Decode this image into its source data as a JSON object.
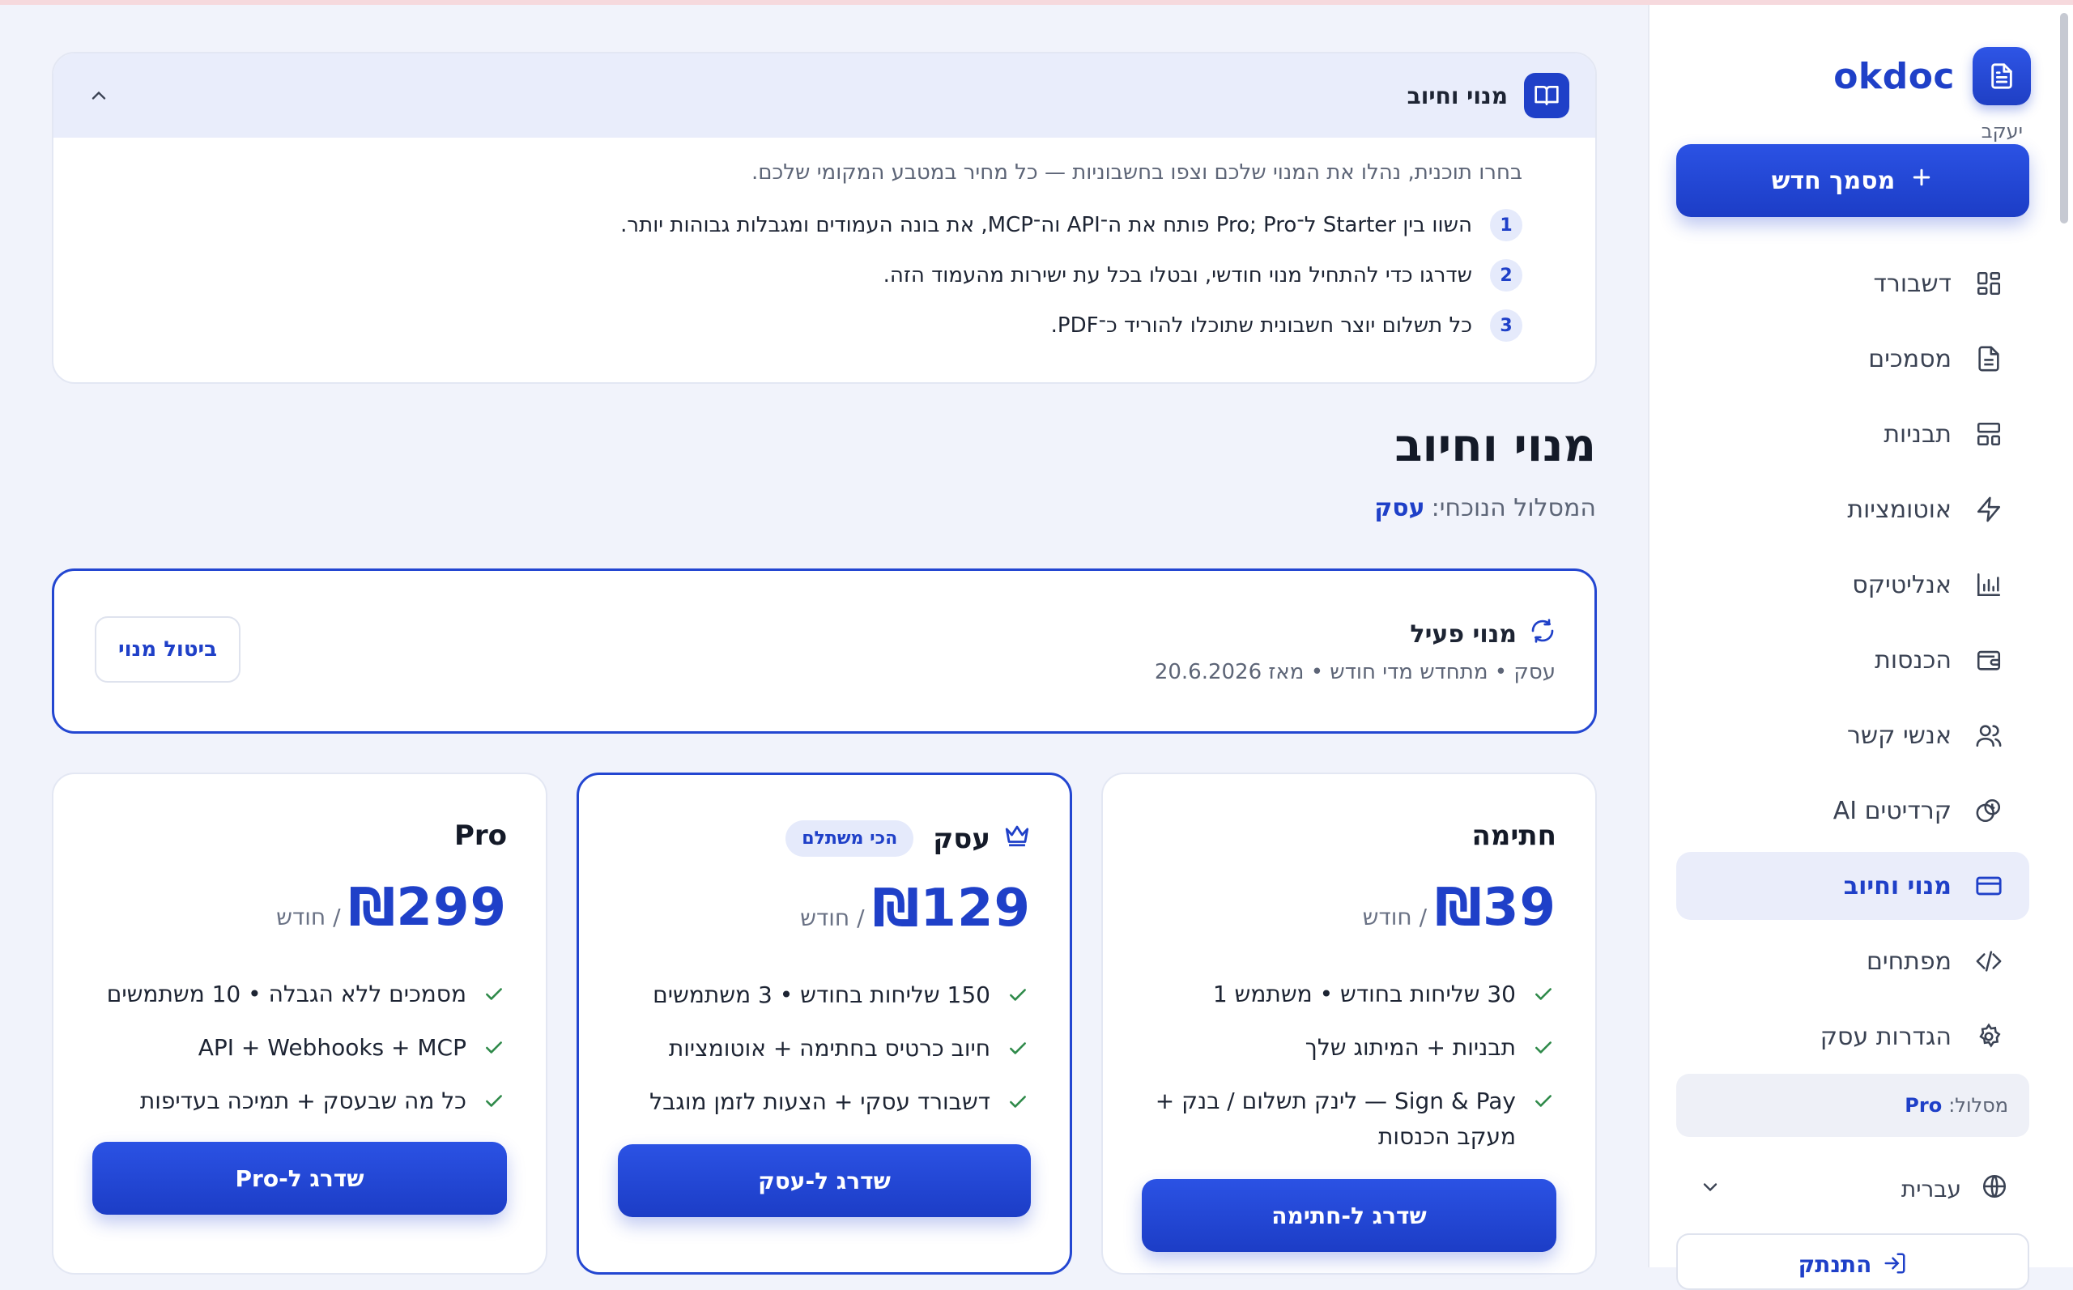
{
  "brand": {
    "name": "okdoc",
    "user": "יעקב"
  },
  "sidebar": {
    "new_doc": "מסמך חדש",
    "items": [
      {
        "label": "דשבורד",
        "icon": "dashboard-icon"
      },
      {
        "label": "מסמכים",
        "icon": "document-icon"
      },
      {
        "label": "תבניות",
        "icon": "templates-icon"
      },
      {
        "label": "אוטומציות",
        "icon": "lightning-icon"
      },
      {
        "label": "אנליטיקס",
        "icon": "analytics-icon"
      },
      {
        "label": "הכנסות",
        "icon": "wallet-icon"
      },
      {
        "label": "אנשי קשר",
        "icon": "contacts-icon"
      },
      {
        "label": "קרדיטים AI",
        "icon": "credits-icon"
      },
      {
        "label": "מנוי וחיוב",
        "icon": "card-icon",
        "active": true
      },
      {
        "label": "מפתחים",
        "icon": "code-icon"
      },
      {
        "label": "הגדרות עסק",
        "icon": "gear-icon"
      }
    ],
    "plan_label": "מסלול:",
    "plan_value": "Pro",
    "language": "עברית",
    "logout": "התנתק"
  },
  "info": {
    "title": "מנוי וחיוב",
    "lead": "בחרו תוכנית, נהלו את המנוי שלכם וצפו בחשבוניות — כל מחיר במטבע המקומי שלכם.",
    "steps": [
      {
        "num": "1",
        "text": "השוו בין Starter ל־Pro; Pro פותח את ה־API וה־MCP, את בונה העמודים ומגבלות גבוהות יותר."
      },
      {
        "num": "2",
        "text": "שדרגו כדי להתחיל מנוי חודשי, ובטלו בכל עת ישירות מהעמוד הזה."
      },
      {
        "num": "3",
        "text": "כל תשלום יוצר חשבונית שתוכלו להוריד כ־PDF."
      }
    ]
  },
  "page": {
    "title": "מנוי וחיוב",
    "current_label": "המסלול הנוכחי:",
    "current_value": "עסק"
  },
  "subscription": {
    "title": "מנוי פעיל",
    "meta": "עסק • מתחדש מדי חודש • מאז 20.6.2026",
    "cancel": "ביטול מנוי"
  },
  "plans": [
    {
      "name": "חתימה",
      "price": "₪39",
      "per": "/ חודש",
      "features": [
        "30 שליחות בחודש • משתמש 1",
        "תבניות + המיתוג שלך",
        "Sign & Pay — לינק תשלום / בנק + מעקב הכנסות"
      ],
      "cta": "שדרג ל-חתימה"
    },
    {
      "name": "עסק",
      "badge": "הכי משתלם",
      "price": "₪129",
      "per": "/ חודש",
      "features": [
        "150 שליחות בחודש • 3 משתמשים",
        "חיוב כרטיס בחתימה + אוטומציות",
        "דשבורד עסקי + הצעות לזמן מוגבל"
      ],
      "cta": "שדרג ל-עסק"
    },
    {
      "name": "Pro",
      "price": "₪299",
      "per": "/ חודש",
      "features": [
        "מסמכים ללא הגבלה • 10 משתמשים",
        "API + Webhooks + MCP",
        "כל מה שבעסק + תמיכה בעדיפות"
      ],
      "cta": "שדרג ל-Pro"
    }
  ],
  "colors": {
    "accent": "#1f40c8",
    "background": "#f1f3fb",
    "check": "#2f8a4a"
  }
}
